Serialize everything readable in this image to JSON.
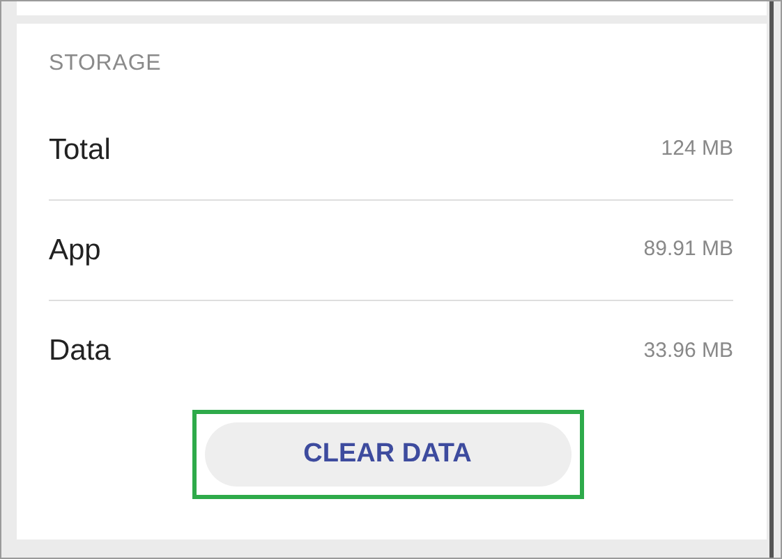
{
  "section_title": "STORAGE",
  "rows": [
    {
      "label": "Total",
      "value": "124 MB"
    },
    {
      "label": "App",
      "value": "89.91 MB"
    },
    {
      "label": "Data",
      "value": "33.96 MB"
    }
  ],
  "button": {
    "label": "CLEAR DATA",
    "highlighted": true
  }
}
